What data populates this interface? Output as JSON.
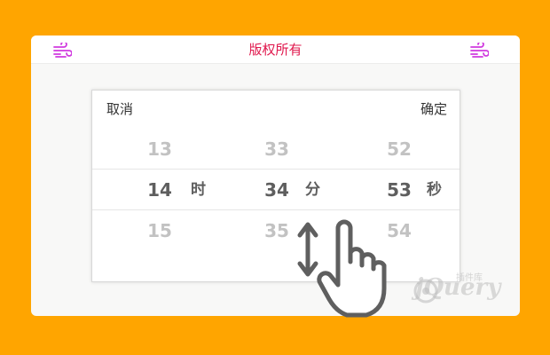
{
  "header": {
    "title": "版权所有",
    "left_icon": "wind-icon",
    "right_icon": "wind-icon",
    "accent_color": "#e0184d",
    "icon_color": "#d03adf"
  },
  "picker": {
    "cancel_label": "取消",
    "confirm_label": "确定",
    "columns": [
      {
        "above": "13",
        "selected": "14",
        "below": "15",
        "unit": "时"
      },
      {
        "above": "33",
        "selected": "34",
        "below": "35",
        "unit": "分"
      },
      {
        "above": "52",
        "selected": "53",
        "below": "54",
        "unit": "秒"
      }
    ]
  },
  "overlay": {
    "gesture_icon": "swipe-vertical-hand-icon",
    "watermark_text": "jQuery",
    "watermark_sub": "插件库"
  },
  "colors": {
    "background": "#FFA500",
    "card": "#f8f8f7",
    "selected_text": "#5e5e5e",
    "faded_text": "#c2c2c2"
  }
}
